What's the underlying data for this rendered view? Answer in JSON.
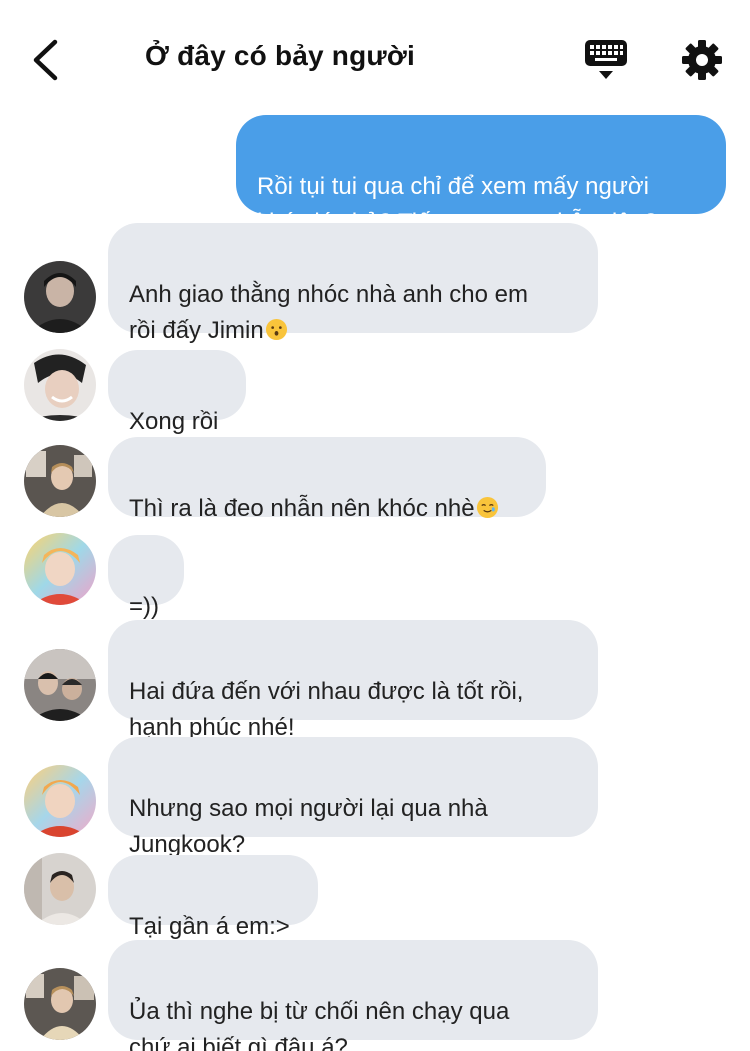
{
  "header": {
    "title": "Ở đây có bảy người",
    "back_icon": "chevron-left-icon",
    "keyboard_icon": "keyboard-icon",
    "settings_icon": "gear-icon"
  },
  "colors": {
    "outgoing_bubble": "#4a9ee8",
    "incoming_bubble": "#e6e9ee",
    "text": "#222222"
  },
  "messages": [
    {
      "direction": "out",
      "text": "Rồi tụi tui qua chỉ để xem mấy người\nkhóc lóc hả? Tiết mục trao nhẫn đâu?"
    },
    {
      "direction": "in",
      "text": "Anh giao thằng nhóc nhà anh cho em\nrồi đấy Jimin",
      "emoji": "kissing-face-emoji"
    },
    {
      "direction": "in",
      "text": "Xong rồi"
    },
    {
      "direction": "in",
      "text": "Thì ra là đeo nhẫn nên khóc nhè",
      "emoji": "smiling-face-with-tear-emoji"
    },
    {
      "direction": "in",
      "text": "=))"
    },
    {
      "direction": "in",
      "text": "Hai đứa đến với nhau được là tốt rồi,\nhạnh phúc nhé!"
    },
    {
      "direction": "in",
      "text": "Nhưng sao mọi người lại qua nhà\nJungkook?"
    },
    {
      "direction": "in",
      "text": "Tại gần á em:>"
    },
    {
      "direction": "in",
      "text": "Ủa thì nghe bị từ chối nên chạy qua\nchứ ai biết gì đâu á?"
    }
  ]
}
